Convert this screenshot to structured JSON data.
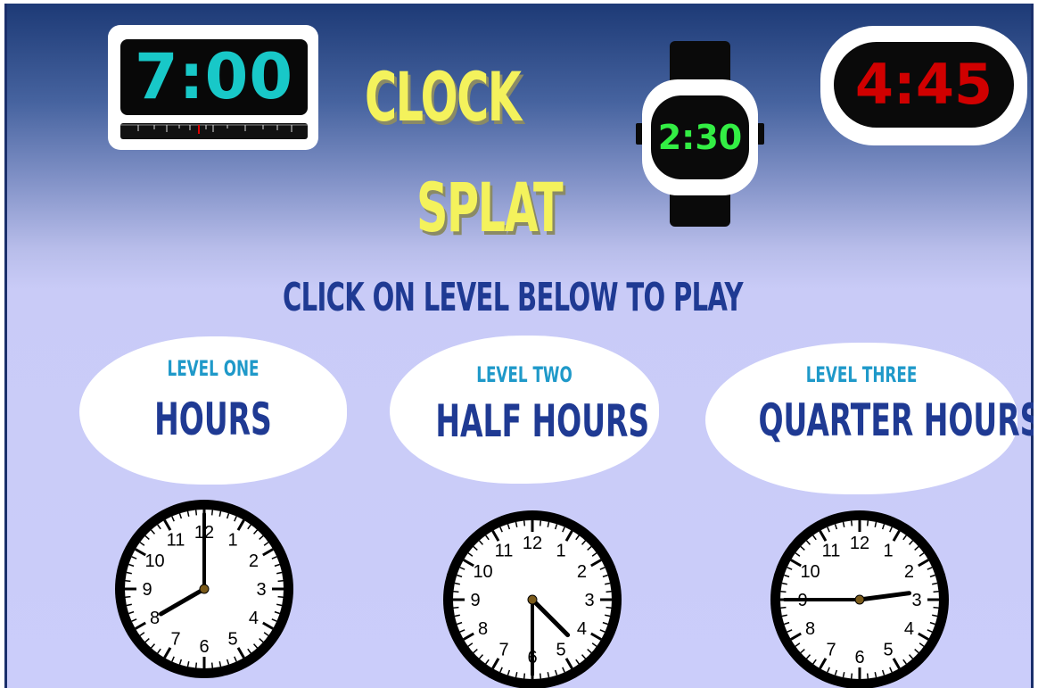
{
  "title": {
    "line1": "CLOCK",
    "line2": "SPLAT"
  },
  "instruction": "CLICK ON LEVEL BELOW TO PLAY",
  "digital_clocks": {
    "alarm_clock": {
      "time": "7:00",
      "color": "#18c8c8"
    },
    "watch": {
      "time": "2:30",
      "color": "#33ee44"
    },
    "rounded_clock": {
      "time": "4:45",
      "color": "#d00000"
    }
  },
  "levels": [
    {
      "level_label": "LEVEL ONE",
      "name": "HOURS",
      "clock_time": "8:00"
    },
    {
      "level_label": "LEVEL TWO",
      "name": "HALF HOURS",
      "clock_time": "4:30"
    },
    {
      "level_label": "LEVEL THREE",
      "name": "QUARTER HOURS",
      "clock_time": "2:45"
    }
  ],
  "clock_numbers": [
    "12",
    "1",
    "2",
    "3",
    "4",
    "5",
    "6",
    "7",
    "8",
    "9",
    "10",
    "11"
  ],
  "colors": {
    "title": "#f4f25c",
    "instruction": "#1f3a93",
    "level_label": "#1f99c9",
    "level_name": "#1f3a93"
  }
}
